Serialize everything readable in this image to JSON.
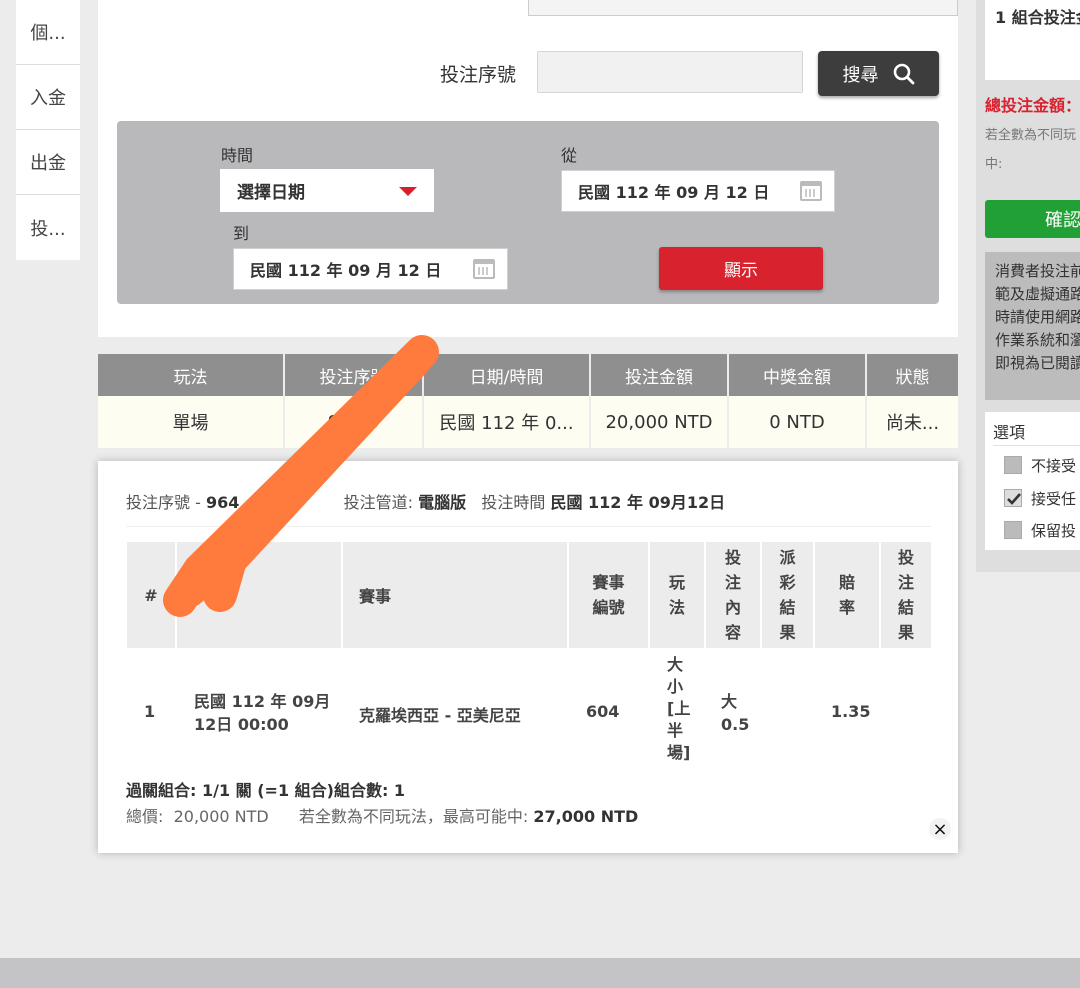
{
  "left_nav": {
    "items": [
      "個...",
      "入金",
      "出金",
      "投..."
    ]
  },
  "search": {
    "label": "投注序號",
    "value": "",
    "button_label": "搜尋"
  },
  "filter": {
    "time_label": "時間",
    "time_select": "選擇日期",
    "from_label": "從",
    "from_date": "民國 112 年 09 月 12 日",
    "to_label": "到",
    "to_date": "民國 112 年 09 月 12 日",
    "show_button": "顯示"
  },
  "summary": {
    "headers": [
      "玩法",
      "投注序號",
      "日期/時間",
      "投注金額",
      "中獎金額",
      "狀態"
    ],
    "row": [
      "單場",
      "9...25",
      "民國 112 年 0...",
      "20,000 NTD",
      "0 NTD",
      "尚未..."
    ]
  },
  "detail": {
    "serial_label": "投注序號",
    "serial_value": "964",
    "channel_label": "投注管道:",
    "channel_value": "電腦版",
    "time_label": "投注時間",
    "time_value": "民國 112 年 09月12日",
    "headers": [
      "#",
      "",
      "賽事",
      "賽事編號",
      "玩法",
      "投注內容",
      "派彩結果",
      "賠率",
      "投注結果"
    ],
    "row": {
      "num": "1",
      "datetime_line1": "民國 112 年 09月",
      "datetime_line2": "12日 00:00",
      "event": "克羅埃西亞 - 亞美尼亞",
      "event_no": "604",
      "play": "大小[上半場]",
      "content_line1": "大",
      "content_line2": "0.5",
      "payout": "",
      "odds": "1.35",
      "result": ""
    },
    "combo": "過關組合: 1/1 關 (=1 組合)組合數: 1",
    "total_label": "總價:",
    "total_value": "20,000 NTD",
    "max_label": "若全數為不同玩法，最高可能中:",
    "max_value": "27,000 NTD",
    "close": "×"
  },
  "right_panel": {
    "combo_text": "1 組合投注金",
    "total_bet": "總投注金額：",
    "note_line1": "若全數為不同玩",
    "note_line2": "中:",
    "confirm": "確認",
    "notice": [
      "消費者投注前",
      "範及虛擬通路",
      "時請使用網路",
      "作業系統和瀏",
      "即視為已閱讀"
    ],
    "options_title": "選項",
    "options": [
      "不接受",
      "接受任",
      "保留投"
    ],
    "options_checked": [
      false,
      true,
      false
    ]
  },
  "colors": {
    "accent_red": "#d8232f",
    "confirm_green": "#21a135",
    "header_grey": "#8f8f8f",
    "stroke_orange": "#ff7a3d"
  }
}
